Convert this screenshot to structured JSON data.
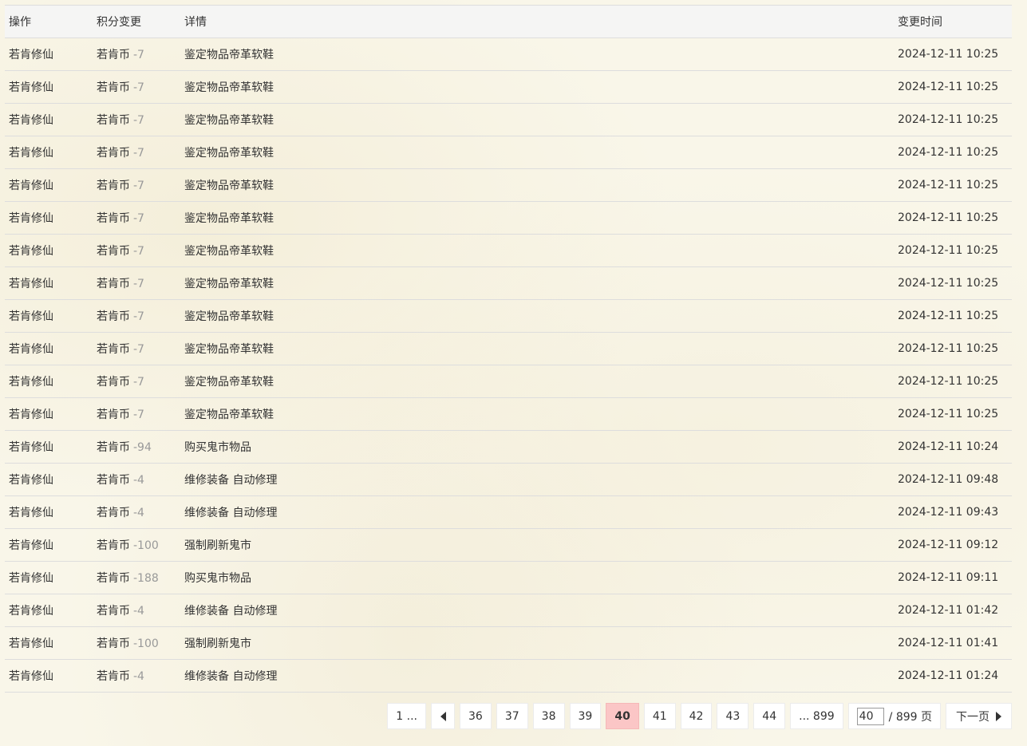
{
  "header": {
    "col_action": "操作",
    "col_points": "积分变更",
    "col_detail": "详情",
    "col_time": "变更时间"
  },
  "rows": [
    {
      "action": "若肯修仙",
      "currency": "若肯币",
      "delta": "-7",
      "detail": "鉴定物品帝革软鞋",
      "time": "2024-12-11 10:25"
    },
    {
      "action": "若肯修仙",
      "currency": "若肯币",
      "delta": "-7",
      "detail": "鉴定物品帝革软鞋",
      "time": "2024-12-11 10:25"
    },
    {
      "action": "若肯修仙",
      "currency": "若肯币",
      "delta": "-7",
      "detail": "鉴定物品帝革软鞋",
      "time": "2024-12-11 10:25"
    },
    {
      "action": "若肯修仙",
      "currency": "若肯币",
      "delta": "-7",
      "detail": "鉴定物品帝革软鞋",
      "time": "2024-12-11 10:25"
    },
    {
      "action": "若肯修仙",
      "currency": "若肯币",
      "delta": "-7",
      "detail": "鉴定物品帝革软鞋",
      "time": "2024-12-11 10:25"
    },
    {
      "action": "若肯修仙",
      "currency": "若肯币",
      "delta": "-7",
      "detail": "鉴定物品帝革软鞋",
      "time": "2024-12-11 10:25"
    },
    {
      "action": "若肯修仙",
      "currency": "若肯币",
      "delta": "-7",
      "detail": "鉴定物品帝革软鞋",
      "time": "2024-12-11 10:25"
    },
    {
      "action": "若肯修仙",
      "currency": "若肯币",
      "delta": "-7",
      "detail": "鉴定物品帝革软鞋",
      "time": "2024-12-11 10:25"
    },
    {
      "action": "若肯修仙",
      "currency": "若肯币",
      "delta": "-7",
      "detail": "鉴定物品帝革软鞋",
      "time": "2024-12-11 10:25"
    },
    {
      "action": "若肯修仙",
      "currency": "若肯币",
      "delta": "-7",
      "detail": "鉴定物品帝革软鞋",
      "time": "2024-12-11 10:25"
    },
    {
      "action": "若肯修仙",
      "currency": "若肯币",
      "delta": "-7",
      "detail": "鉴定物品帝革软鞋",
      "time": "2024-12-11 10:25"
    },
    {
      "action": "若肯修仙",
      "currency": "若肯币",
      "delta": "-7",
      "detail": "鉴定物品帝革软鞋",
      "time": "2024-12-11 10:25"
    },
    {
      "action": "若肯修仙",
      "currency": "若肯币",
      "delta": "-94",
      "detail": "购买鬼市物品",
      "time": "2024-12-11 10:24"
    },
    {
      "action": "若肯修仙",
      "currency": "若肯币",
      "delta": "-4",
      "detail": "维修装备 自动修理",
      "time": "2024-12-11 09:48"
    },
    {
      "action": "若肯修仙",
      "currency": "若肯币",
      "delta": "-4",
      "detail": "维修装备 自动修理",
      "time": "2024-12-11 09:43"
    },
    {
      "action": "若肯修仙",
      "currency": "若肯币",
      "delta": "-100",
      "detail": "强制刷新鬼市",
      "time": "2024-12-11 09:12"
    },
    {
      "action": "若肯修仙",
      "currency": "若肯币",
      "delta": "-188",
      "detail": "购买鬼市物品",
      "time": "2024-12-11 09:11"
    },
    {
      "action": "若肯修仙",
      "currency": "若肯币",
      "delta": "-4",
      "detail": "维修装备 自动修理",
      "time": "2024-12-11 01:42"
    },
    {
      "action": "若肯修仙",
      "currency": "若肯币",
      "delta": "-100",
      "detail": "强制刷新鬼市",
      "time": "2024-12-11 01:41"
    },
    {
      "action": "若肯修仙",
      "currency": "若肯币",
      "delta": "-4",
      "detail": "维修装备 自动修理",
      "time": "2024-12-11 01:24"
    }
  ],
  "pagination": {
    "first": "1 ...",
    "prev_icon": "triangle-left-icon",
    "pages": [
      {
        "label": "36",
        "current": false
      },
      {
        "label": "37",
        "current": false
      },
      {
        "label": "38",
        "current": false
      },
      {
        "label": "39",
        "current": false
      },
      {
        "label": "40",
        "current": true
      },
      {
        "label": "41",
        "current": false
      },
      {
        "label": "42",
        "current": false
      },
      {
        "label": "43",
        "current": false
      },
      {
        "label": "44",
        "current": false
      }
    ],
    "last": "... 899",
    "jump_value": "40",
    "total_text": "/ 899 页",
    "next_label": "下一页",
    "next_icon": "triangle-right-icon",
    "current_color": "#fbc6c6"
  }
}
